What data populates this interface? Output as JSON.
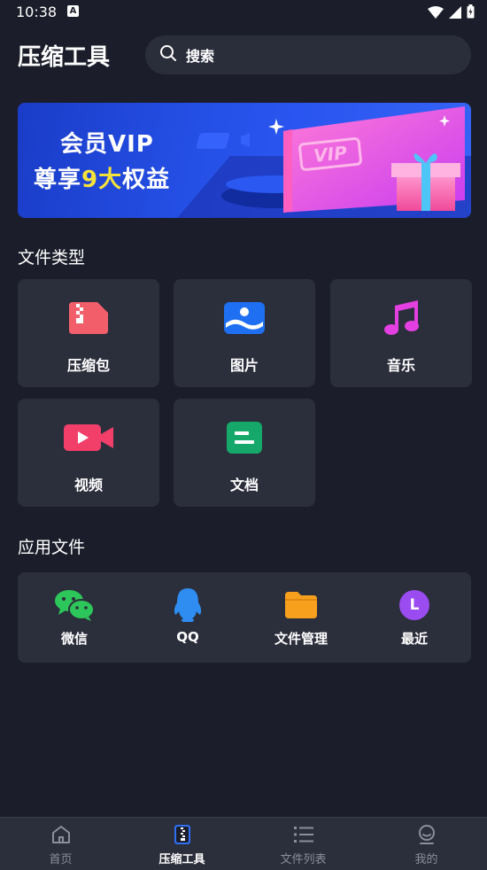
{
  "status_bar": {
    "time": "10:38",
    "notification_badge": "A",
    "icons": [
      "wifi-icon",
      "signal-icon",
      "battery-icon"
    ]
  },
  "header": {
    "title": "压缩工具",
    "search_placeholder": "搜索"
  },
  "banner": {
    "line1": "会员VIP",
    "line2_prefix": "尊享",
    "line2_highlight": "9大",
    "line2_suffix": "权益",
    "badge_text": "VIP"
  },
  "file_types": {
    "title": "文件类型",
    "items": [
      {
        "label": "压缩包",
        "icon": "zip-file-icon",
        "color": "#f25f6a"
      },
      {
        "label": "图片",
        "icon": "image-icon",
        "color": "#1f6ff2"
      },
      {
        "label": "音乐",
        "icon": "music-note-icon",
        "color": "#e43fe0"
      },
      {
        "label": "视频",
        "icon": "video-camera-icon",
        "color": "#f23f6a"
      },
      {
        "label": "文档",
        "icon": "document-icon",
        "color": "#16a86a"
      }
    ]
  },
  "app_files": {
    "title": "应用文件",
    "items": [
      {
        "label": "微信",
        "icon": "wechat-icon",
        "color": "#2dc65a"
      },
      {
        "label": "QQ",
        "icon": "qq-penguin-icon",
        "color": "#2f8cf0"
      },
      {
        "label": "文件管理",
        "icon": "folder-icon",
        "color": "#f7a01e"
      },
      {
        "label": "最近",
        "icon": "recent-l-icon",
        "color": "#9a4cf0",
        "glyph": "L"
      }
    ]
  },
  "bottom_nav": {
    "items": [
      {
        "label": "首页",
        "icon": "home-icon",
        "active": false
      },
      {
        "label": "压缩工具",
        "icon": "zip-tool-icon",
        "active": true
      },
      {
        "label": "文件列表",
        "icon": "list-icon",
        "active": false
      },
      {
        "label": "我的",
        "icon": "profile-icon",
        "active": false
      }
    ]
  },
  "colors": {
    "background": "#1b1e2a",
    "card": "#2b2e3b",
    "accent_blue": "#2550e6",
    "highlight_yellow": "#f7e23a"
  }
}
